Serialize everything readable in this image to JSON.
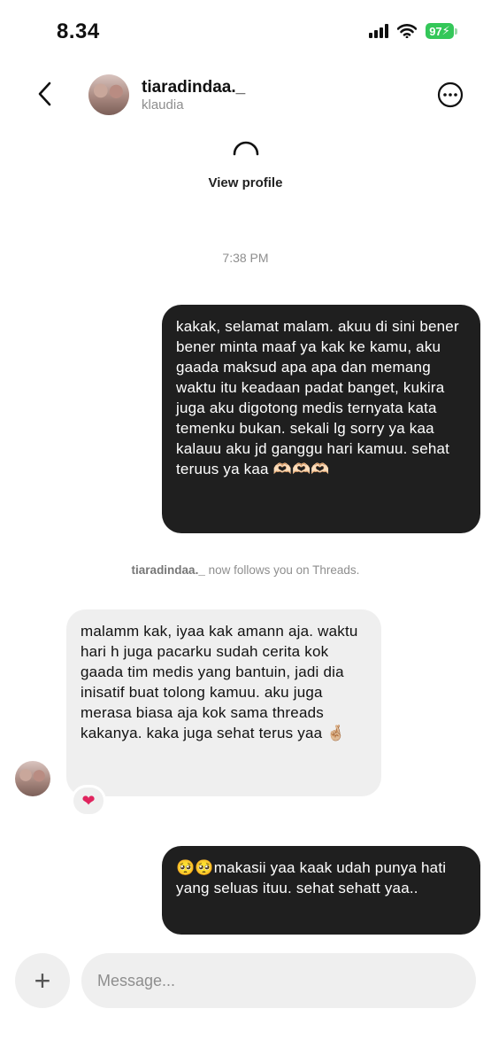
{
  "status_bar": {
    "time": "8.34",
    "battery": "97"
  },
  "header": {
    "username": "tiaradindaa._",
    "subtitle": "klaudia"
  },
  "profile": {
    "view_profile": "View profile"
  },
  "conversation": {
    "timestamp": "7:38 PM",
    "messages": [
      {
        "direction": "sent",
        "text": "kakak, selamat malam. akuu di sini bener bener minta maaf ya kak ke kamu, aku gaada maksud apa apa dan memang waktu itu keadaan padat banget, kukira juga aku digotong medis ternyata kata temenku bukan. sekali lg sorry ya kaa kalauu aku jd ganggu hari kamuu. sehat teruus ya kaa 🫶🏻🫶🏻🫶🏻"
      },
      {
        "direction": "received",
        "text": "malamm kak, iyaa kak amann aja. waktu hari h juga pacarku sudah cerita kok gaada tim medis yang bantuin, jadi dia inisatif buat tolong kamuu. aku juga merasa biasa aja kok sama threads kakanya. kaka juga sehat terus yaa 🤞🏼",
        "reaction": "❤"
      },
      {
        "direction": "sent",
        "text": "🥺🥺makasii yaa kaak udah punya hati yang seluas ituu. sehat sehatt yaa.."
      }
    ],
    "system_note": {
      "user": "tiaradindaa._",
      "text": " now follows you on Threads."
    }
  },
  "composer": {
    "plus_label": "+",
    "placeholder": "Message..."
  },
  "colors": {
    "sent_bubble": "#1f1f1f",
    "received_bubble": "#efefef",
    "battery": "#34c759"
  }
}
